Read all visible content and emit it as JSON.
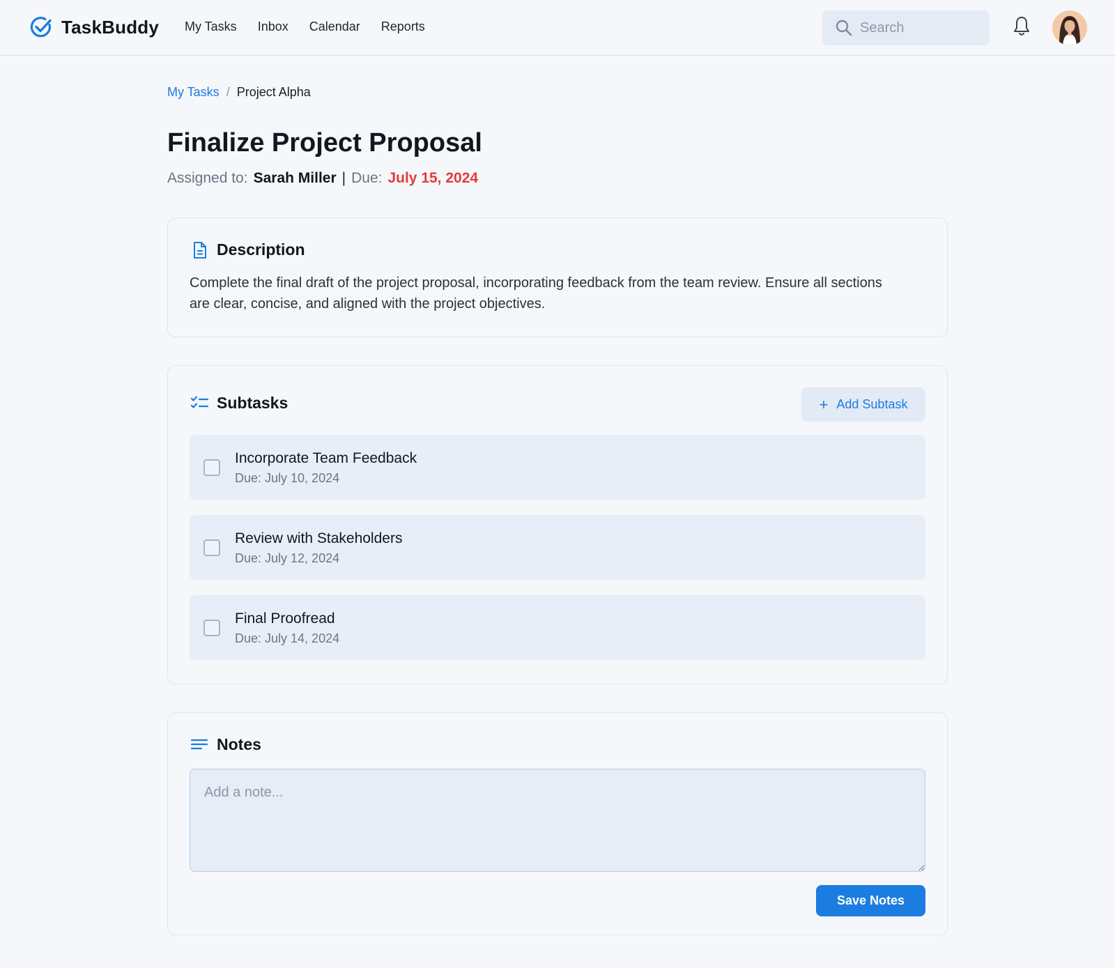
{
  "app": {
    "name": "TaskBuddy",
    "accent": "#1b7de0",
    "danger": "#e53a3a"
  },
  "nav": {
    "items": [
      "My Tasks",
      "Inbox",
      "Calendar",
      "Reports"
    ]
  },
  "search": {
    "placeholder": "Search",
    "value": ""
  },
  "breadcrumb": {
    "parent": "My Tasks",
    "separator": "/",
    "current": "Project Alpha"
  },
  "task": {
    "title": "Finalize Project Proposal",
    "assigned_label": "Assigned to:",
    "assignee": "Sarah Miller",
    "divider": "|",
    "due_label": "Due:",
    "due_date": "July 15, 2024"
  },
  "description": {
    "heading": "Description",
    "text": "Complete the final draft of the project proposal, incorporating feedback from the team review. Ensure all sections are clear, concise, and aligned with the project objectives."
  },
  "subtasks": {
    "heading": "Subtasks",
    "add_label": "Add Subtask",
    "items": [
      {
        "name": "Incorporate Team Feedback",
        "due": "Due: July 10, 2024",
        "checked": false
      },
      {
        "name": "Review with Stakeholders",
        "due": "Due: July 12, 2024",
        "checked": false
      },
      {
        "name": "Final Proofread",
        "due": "Due: July 14, 2024",
        "checked": false
      }
    ]
  },
  "notes": {
    "heading": "Notes",
    "placeholder": "Add a note...",
    "value": "",
    "save_label": "Save Notes"
  },
  "icons": {
    "brand": "check-circle-icon",
    "search": "search-icon",
    "notifications": "bell-icon",
    "description": "document-icon",
    "subtasks": "checklist-icon",
    "notes": "lines-icon",
    "add": "plus-icon"
  }
}
